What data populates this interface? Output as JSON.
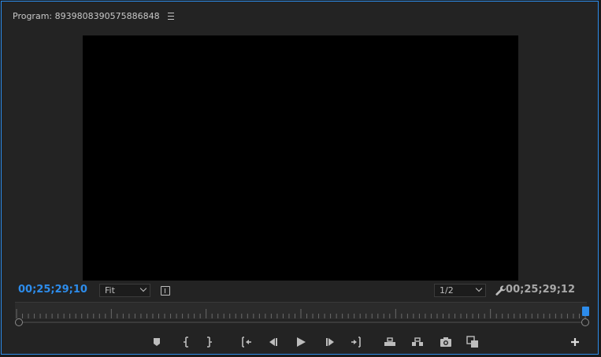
{
  "panel": {
    "title": "Program: 8939808390575886848",
    "menu_icon": "hamburger-menu-icon"
  },
  "timecode": {
    "current": "00;25;29;10",
    "duration": "00;25;29;12"
  },
  "zoom": {
    "selected": "Fit"
  },
  "resolution": {
    "selected": "1/2"
  },
  "colors": {
    "accent": "#2d8ceb",
    "panel_bg": "#232323",
    "viewport_bg": "#000000"
  },
  "controls": [
    {
      "name": "add-marker-icon"
    },
    {
      "name": "mark-in-icon"
    },
    {
      "name": "mark-out-icon"
    },
    {
      "name": "go-to-in-icon"
    },
    {
      "name": "step-back-icon"
    },
    {
      "name": "play-icon"
    },
    {
      "name": "step-forward-icon"
    },
    {
      "name": "go-to-out-icon"
    },
    {
      "name": "lift-icon"
    },
    {
      "name": "extract-icon"
    },
    {
      "name": "export-frame-icon"
    },
    {
      "name": "comparison-view-icon"
    },
    {
      "name": "add-button-icon"
    }
  ]
}
